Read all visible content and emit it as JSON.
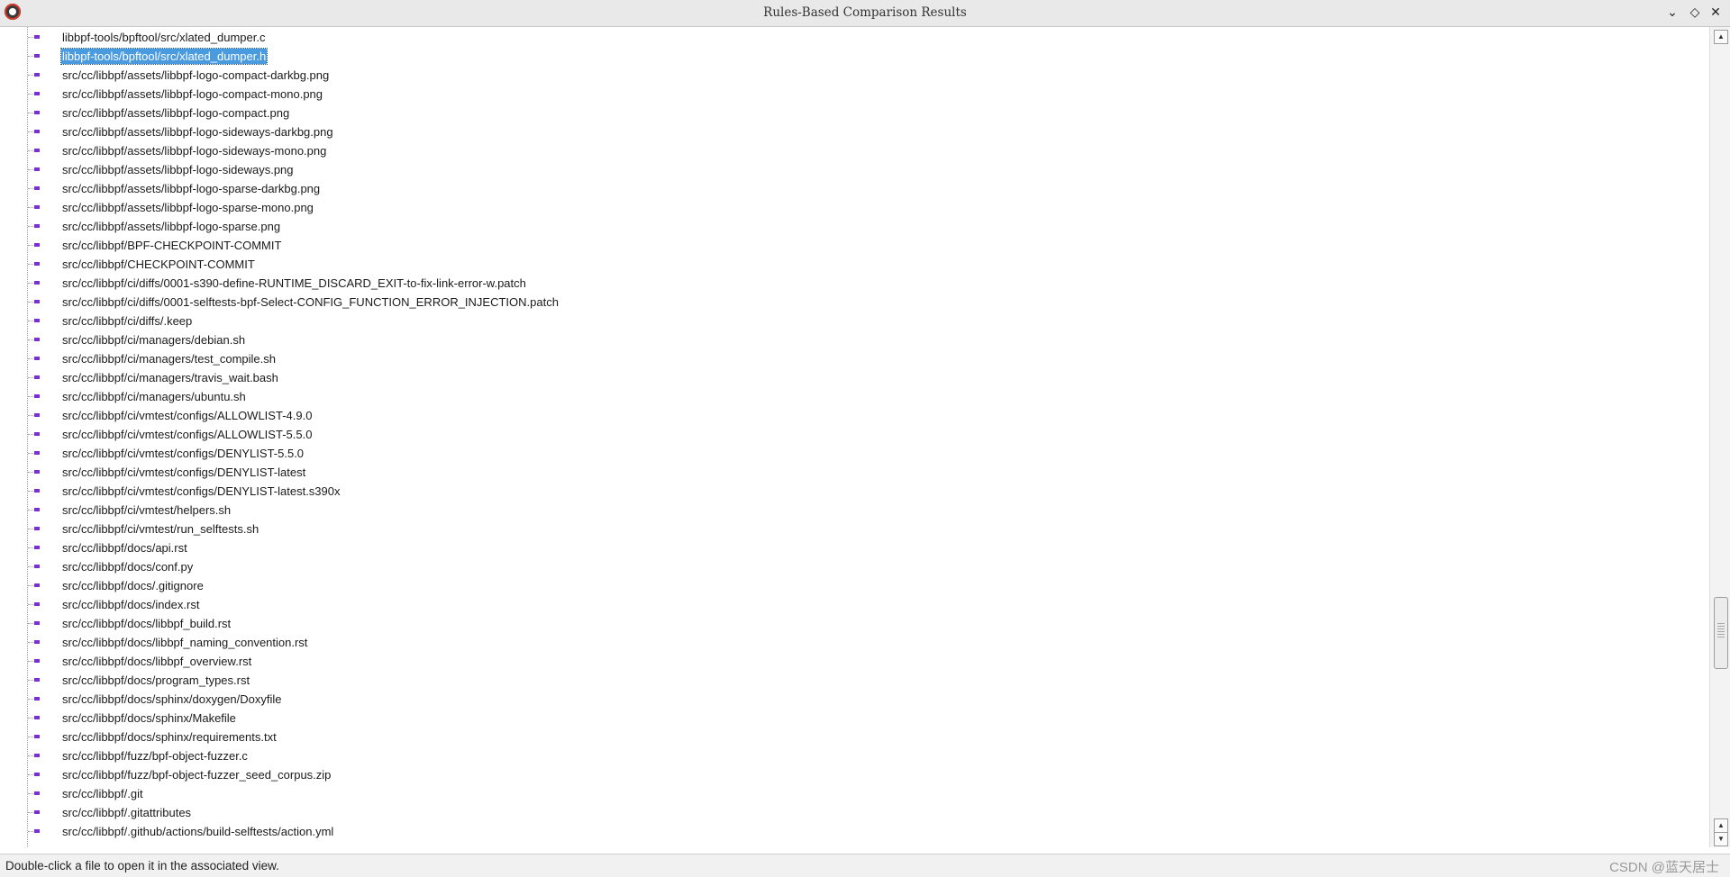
{
  "window": {
    "title": "Rules-Based Comparison Results",
    "controls": [
      "chevron-down-icon",
      "restore-icon",
      "close-icon"
    ]
  },
  "tree": {
    "selected_index": 1,
    "items": [
      "libbpf-tools/bpftool/src/xlated_dumper.c",
      "libbpf-tools/bpftool/src/xlated_dumper.h",
      "src/cc/libbpf/assets/libbpf-logo-compact-darkbg.png",
      "src/cc/libbpf/assets/libbpf-logo-compact-mono.png",
      "src/cc/libbpf/assets/libbpf-logo-compact.png",
      "src/cc/libbpf/assets/libbpf-logo-sideways-darkbg.png",
      "src/cc/libbpf/assets/libbpf-logo-sideways-mono.png",
      "src/cc/libbpf/assets/libbpf-logo-sideways.png",
      "src/cc/libbpf/assets/libbpf-logo-sparse-darkbg.png",
      "src/cc/libbpf/assets/libbpf-logo-sparse-mono.png",
      "src/cc/libbpf/assets/libbpf-logo-sparse.png",
      "src/cc/libbpf/BPF-CHECKPOINT-COMMIT",
      "src/cc/libbpf/CHECKPOINT-COMMIT",
      "src/cc/libbpf/ci/diffs/0001-s390-define-RUNTIME_DISCARD_EXIT-to-fix-link-error-w.patch",
      "src/cc/libbpf/ci/diffs/0001-selftests-bpf-Select-CONFIG_FUNCTION_ERROR_INJECTION.patch",
      "src/cc/libbpf/ci/diffs/.keep",
      "src/cc/libbpf/ci/managers/debian.sh",
      "src/cc/libbpf/ci/managers/test_compile.sh",
      "src/cc/libbpf/ci/managers/travis_wait.bash",
      "src/cc/libbpf/ci/managers/ubuntu.sh",
      "src/cc/libbpf/ci/vmtest/configs/ALLOWLIST-4.9.0",
      "src/cc/libbpf/ci/vmtest/configs/ALLOWLIST-5.5.0",
      "src/cc/libbpf/ci/vmtest/configs/DENYLIST-5.5.0",
      "src/cc/libbpf/ci/vmtest/configs/DENYLIST-latest",
      "src/cc/libbpf/ci/vmtest/configs/DENYLIST-latest.s390x",
      "src/cc/libbpf/ci/vmtest/helpers.sh",
      "src/cc/libbpf/ci/vmtest/run_selftests.sh",
      "src/cc/libbpf/docs/api.rst",
      "src/cc/libbpf/docs/conf.py",
      "src/cc/libbpf/docs/.gitignore",
      "src/cc/libbpf/docs/index.rst",
      "src/cc/libbpf/docs/libbpf_build.rst",
      "src/cc/libbpf/docs/libbpf_naming_convention.rst",
      "src/cc/libbpf/docs/libbpf_overview.rst",
      "src/cc/libbpf/docs/program_types.rst",
      "src/cc/libbpf/docs/sphinx/doxygen/Doxyfile",
      "src/cc/libbpf/docs/sphinx/Makefile",
      "src/cc/libbpf/docs/sphinx/requirements.txt",
      "src/cc/libbpf/fuzz/bpf-object-fuzzer.c",
      "src/cc/libbpf/fuzz/bpf-object-fuzzer_seed_corpus.zip",
      "src/cc/libbpf/.git",
      "src/cc/libbpf/.gitattributes",
      "src/cc/libbpf/.github/actions/build-selftests/action.yml"
    ]
  },
  "scrollbar": {
    "position_fraction": 0.72
  },
  "status": {
    "text": "Double-click a file to open it in the associated view.",
    "watermark": "CSDN @蓝天居士"
  },
  "colors": {
    "file_icon": "#7a2fd1",
    "selection": "#4a9ae0"
  }
}
